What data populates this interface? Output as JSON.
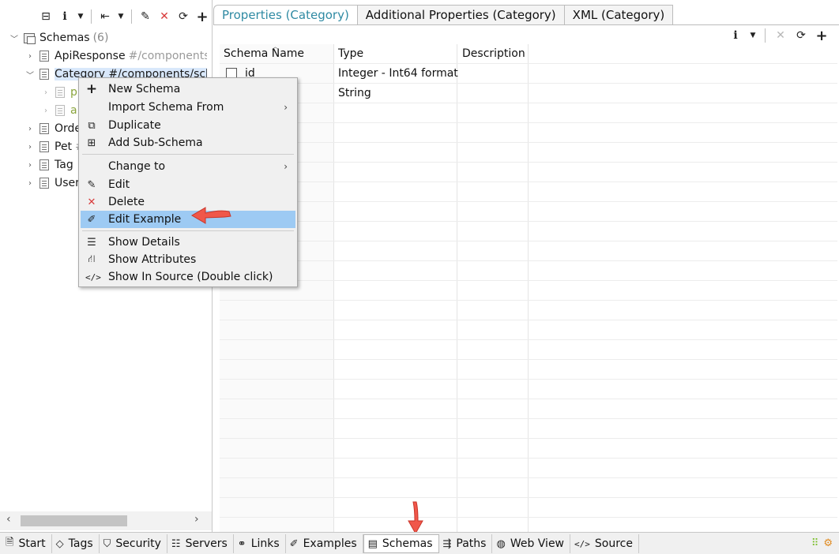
{
  "left_toolbar": {
    "icons": [
      "collapse-all-icon",
      "info-icon",
      "dropdown-icon",
      "export-icon",
      "dropdown-icon",
      "edit-icon",
      "delete-icon",
      "refresh-icon",
      "add-icon"
    ]
  },
  "tree": {
    "root": {
      "label": "Schemas",
      "count": "(6)"
    },
    "items": [
      {
        "label": "ApiResponse",
        "path": "#/components/"
      },
      {
        "label": "Category",
        "path": "#/components/sche"
      },
      {
        "label": "p"
      },
      {
        "label": "a"
      },
      {
        "label": "Orde"
      },
      {
        "label": "Pet",
        "path": "#"
      },
      {
        "label": "Tag"
      },
      {
        "label": "User"
      }
    ]
  },
  "tabs": [
    {
      "label": "Properties (Category)",
      "active": true
    },
    {
      "label": "Additional Properties (Category)"
    },
    {
      "label": "XML (Category)"
    }
  ],
  "grid": {
    "columns": [
      "Schema Name",
      "Type",
      "Description"
    ],
    "rows": [
      {
        "name": "id",
        "type": "Integer - Int64 format",
        "description": ""
      },
      {
        "name": "",
        "type": "String",
        "description": ""
      }
    ]
  },
  "context_menu": {
    "items": [
      {
        "label": "New Schema",
        "icon": "plus-icon"
      },
      {
        "label": "Import Schema From",
        "icon": "",
        "submenu": true
      },
      {
        "label": "Duplicate",
        "icon": "duplicate-icon"
      },
      {
        "label": "Add Sub-Schema",
        "icon": "add-subschema-icon"
      },
      {
        "label": "Change to",
        "icon": "",
        "submenu": true
      },
      {
        "label": "Edit",
        "icon": "pencil-icon"
      },
      {
        "label": "Delete",
        "icon": "delete-icon"
      },
      {
        "label": "Edit Example",
        "icon": "edit-example-icon",
        "highlighted": true
      },
      {
        "label": "Show Details",
        "icon": "details-icon"
      },
      {
        "label": "Show Attributes",
        "icon": "hierarchy-icon"
      },
      {
        "label": "Show In Source (Double click)",
        "icon": "source-icon"
      }
    ]
  },
  "bottom_tabs": [
    {
      "label": "Start",
      "icon": "start-icon"
    },
    {
      "label": "Tags",
      "icon": "tag-icon"
    },
    {
      "label": "Security",
      "icon": "shield-icon"
    },
    {
      "label": "Servers",
      "icon": "servers-icon"
    },
    {
      "label": "Links",
      "icon": "link-icon"
    },
    {
      "label": "Examples",
      "icon": "examples-icon"
    },
    {
      "label": "Schemas",
      "icon": "schemas-icon",
      "active": true
    },
    {
      "label": "Paths",
      "icon": "paths-icon"
    },
    {
      "label": "Web View",
      "icon": "globe-icon"
    },
    {
      "label": "Source",
      "icon": "source-icon"
    }
  ],
  "colors": {
    "accent_tab": "#2f8aa3",
    "menu_highlight": "#9dcaf3",
    "selection": "#d9e8fb",
    "annotation_arrow": "#f0574a"
  }
}
